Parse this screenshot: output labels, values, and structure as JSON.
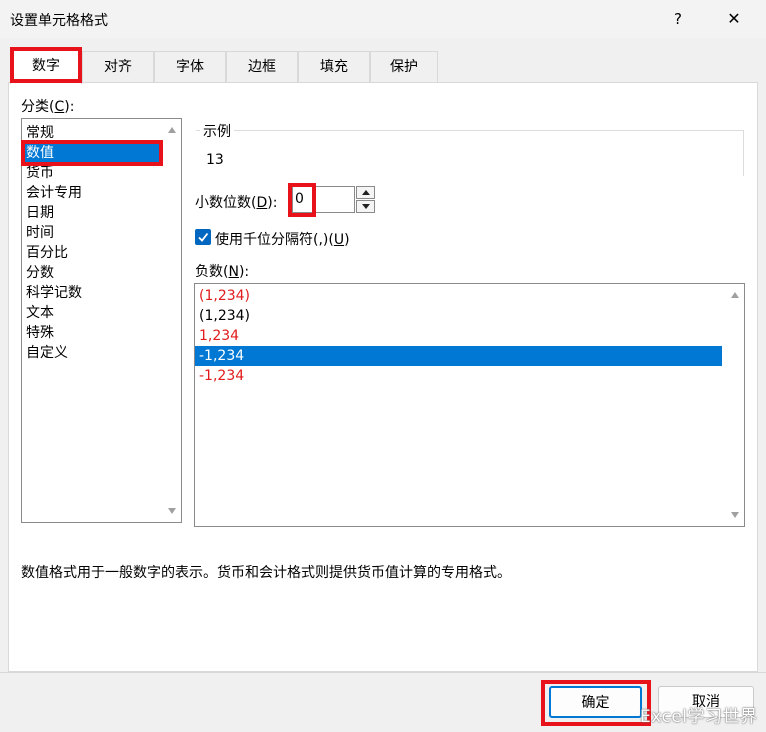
{
  "window": {
    "title": "设置单元格格式",
    "help_label": "?",
    "close_label": "✕"
  },
  "tabs": [
    {
      "label": "数字",
      "active": true
    },
    {
      "label": "对齐"
    },
    {
      "label": "字体"
    },
    {
      "label": "边框"
    },
    {
      "label": "填充"
    },
    {
      "label": "保护"
    }
  ],
  "category": {
    "label_prefix": "分类(",
    "label_key": "C",
    "label_suffix": "):",
    "items": [
      "常规",
      "数值",
      "货币",
      "会计专用",
      "日期",
      "时间",
      "百分比",
      "分数",
      "科学记数",
      "文本",
      "特殊",
      "自定义"
    ],
    "selected": "数值"
  },
  "sample": {
    "label": "示例",
    "value": "13"
  },
  "decimal": {
    "label_prefix": "小数位数(",
    "label_key": "D",
    "label_suffix": "):",
    "value": "0"
  },
  "thousands": {
    "label_prefix": "使用千位分隔符(,)(",
    "label_key": "U",
    "label_suffix": ")",
    "checked": true
  },
  "negative": {
    "label_prefix": "负数(",
    "label_key": "N",
    "label_suffix": "):",
    "items": [
      {
        "text": "(1,234)",
        "color": "red"
      },
      {
        "text": "(1,234)",
        "color": "black"
      },
      {
        "text": "1,234",
        "color": "red"
      },
      {
        "text": "-1,234",
        "color": "black",
        "selected": true
      },
      {
        "text": "-1,234",
        "color": "red"
      }
    ]
  },
  "description": "数值格式用于一般数字的表示。货币和会计格式则提供货币值计算的专用格式。",
  "buttons": {
    "ok": "确定",
    "cancel": "取消"
  },
  "watermark": "Excel学习世界",
  "colors": {
    "accent": "#0078d4",
    "highlight_box": "#e8121b",
    "negative_red": "#e11b1b"
  }
}
